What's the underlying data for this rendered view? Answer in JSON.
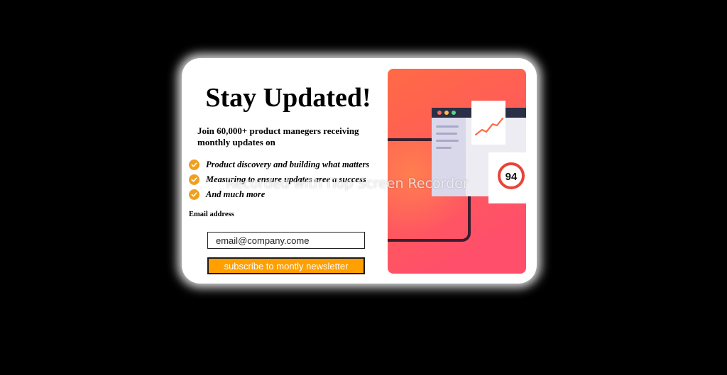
{
  "newsletter": {
    "title": "Stay Updated!",
    "intro": "Join 60,000+ product manegers receiving monthly updates on",
    "features": [
      {
        "text": "Product discovery and building what matters",
        "icon": "check-icon"
      },
      {
        "text": "Measuring to ensure updates aree a success",
        "icon": "check-icon"
      },
      {
        "text": "And much more",
        "icon": "check-icon"
      }
    ],
    "email_label": "Email address",
    "email_placeholder": "email@company.come",
    "subscribe_label": "subscribe to montly newsletter"
  },
  "illustration": {
    "score": "94"
  },
  "watermark": "Recorded with iTop Screen Recorder",
  "colors": {
    "background": "#000000",
    "card": "#ffffff",
    "accent": "#ff9f00",
    "check": "#f0a020",
    "hero_top": "#ff6a45",
    "hero_bottom": "#ff4f6b",
    "score_ring": "#e8443a"
  }
}
